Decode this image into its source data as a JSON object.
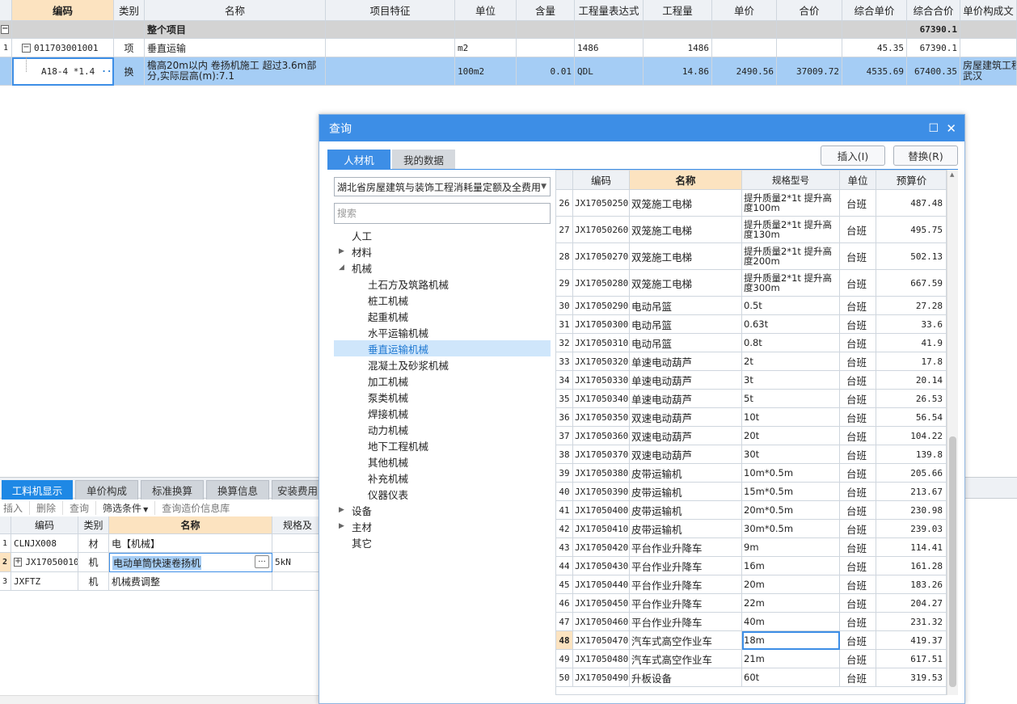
{
  "top_grid": {
    "headers": [
      "编码",
      "类别",
      "名称",
      "项目特征",
      "单位",
      "含量",
      "工程量表达式",
      "工程量",
      "单价",
      "合价",
      "综合单价",
      "综合合价",
      "单价构成文"
    ],
    "summary_row": {
      "name": "整个项目",
      "total": "67390.1"
    },
    "row1": {
      "idx": "1",
      "code": "011703001001",
      "type": "项",
      "name": "垂直运输",
      "unit": "m2",
      "expr": "1486",
      "qty": "1486",
      "unit_price": "45.35",
      "total": "67390.1"
    },
    "row2": {
      "code": "A18-4 *1.4",
      "type": "换",
      "name_line1": "檐高20m以内 卷扬机施工  超过3.6m部",
      "name_line2": "分,实际层高(m):7.1",
      "unit": "100m2",
      "content": "0.01",
      "expr": "QDL",
      "qty": "14.86",
      "price": "2490.56",
      "amount": "37009.72",
      "unit_price": "4535.69",
      "total": "67400.35",
      "source_line1": "房屋建筑工程",
      "source_line2": "武汉"
    }
  },
  "bottom_panel": {
    "tabs": [
      "工料机显示",
      "单价构成",
      "标准换算",
      "换算信息",
      "安装费用"
    ],
    "toolbar": [
      "插入",
      "删除",
      "查询",
      "筛选条件",
      "查询造价信息库"
    ],
    "headers": [
      "编码",
      "类别",
      "名称",
      "规格及"
    ],
    "rows": [
      {
        "idx": "1",
        "code": "CLNJX008",
        "type": "材",
        "name": "电【机械】",
        "spec": ""
      },
      {
        "idx": "2",
        "code": "JX17050010",
        "type": "机",
        "name": "电动单筒快速卷扬机",
        "spec": "5kN"
      },
      {
        "idx": "3",
        "code": "JXFTZ",
        "type": "机",
        "name": "机械费调整",
        "spec": ""
      }
    ]
  },
  "dialog": {
    "title": "查询",
    "tabs": [
      "人材机",
      "我的数据"
    ],
    "insert_button": "插入(I)",
    "replace_button": "替换(R)",
    "quota_select": "湖北省房屋建筑与装饰工程消耗量定额及全费用",
    "search_placeholder": "搜索",
    "tree": [
      {
        "label": "人工",
        "level": 1,
        "arrow": ""
      },
      {
        "label": "材料",
        "level": 1,
        "arrow": "▶"
      },
      {
        "label": "机械",
        "level": 1,
        "arrow": "◢"
      },
      {
        "label": "土石方及筑路机械",
        "level": 2,
        "arrow": ""
      },
      {
        "label": "桩工机械",
        "level": 2,
        "arrow": ""
      },
      {
        "label": "起重机械",
        "level": 2,
        "arrow": ""
      },
      {
        "label": "水平运输机械",
        "level": 2,
        "arrow": ""
      },
      {
        "label": "垂直运输机械",
        "level": 2,
        "arrow": "",
        "selected": true
      },
      {
        "label": "混凝土及砂浆机械",
        "level": 2,
        "arrow": ""
      },
      {
        "label": "加工机械",
        "level": 2,
        "arrow": ""
      },
      {
        "label": "泵类机械",
        "level": 2,
        "arrow": ""
      },
      {
        "label": "焊接机械",
        "level": 2,
        "arrow": ""
      },
      {
        "label": "动力机械",
        "level": 2,
        "arrow": ""
      },
      {
        "label": "地下工程机械",
        "level": 2,
        "arrow": ""
      },
      {
        "label": "其他机械",
        "level": 2,
        "arrow": ""
      },
      {
        "label": "补充机械",
        "level": 2,
        "arrow": ""
      },
      {
        "label": "仪器仪表",
        "level": 2,
        "arrow": ""
      },
      {
        "label": "设备",
        "level": 1,
        "arrow": "▶"
      },
      {
        "label": "主材",
        "level": 1,
        "arrow": "▶"
      },
      {
        "label": "其它",
        "level": 1,
        "arrow": ""
      }
    ],
    "table_headers": [
      "编码",
      "名称",
      "规格型号",
      "单位",
      "预算价"
    ],
    "rows": [
      {
        "n": "26",
        "code": "JX17050250",
        "name": "双笼施工电梯",
        "spec": "提升质量2*1t 提升高度100m",
        "unit": "台班",
        "price": "487.48"
      },
      {
        "n": "27",
        "code": "JX17050260",
        "name": "双笼施工电梯",
        "spec": "提升质量2*1t 提升高度130m",
        "unit": "台班",
        "price": "495.75"
      },
      {
        "n": "28",
        "code": "JX17050270",
        "name": "双笼施工电梯",
        "spec": "提升质量2*1t 提升高度200m",
        "unit": "台班",
        "price": "502.13"
      },
      {
        "n": "29",
        "code": "JX17050280",
        "name": "双笼施工电梯",
        "spec": "提升质量2*1t 提升高度300m",
        "unit": "台班",
        "price": "667.59"
      },
      {
        "n": "30",
        "code": "JX17050290",
        "name": "电动吊篮",
        "spec": "0.5t",
        "unit": "台班",
        "price": "27.28"
      },
      {
        "n": "31",
        "code": "JX17050300",
        "name": "电动吊篮",
        "spec": "0.63t",
        "unit": "台班",
        "price": "33.6"
      },
      {
        "n": "32",
        "code": "JX17050310",
        "name": "电动吊篮",
        "spec": "0.8t",
        "unit": "台班",
        "price": "41.9"
      },
      {
        "n": "33",
        "code": "JX17050320",
        "name": "单速电动葫芦",
        "spec": "2t",
        "unit": "台班",
        "price": "17.8"
      },
      {
        "n": "34",
        "code": "JX17050330",
        "name": "单速电动葫芦",
        "spec": "3t",
        "unit": "台班",
        "price": "20.14"
      },
      {
        "n": "35",
        "code": "JX17050340",
        "name": "单速电动葫芦",
        "spec": "5t",
        "unit": "台班",
        "price": "26.53"
      },
      {
        "n": "36",
        "code": "JX17050350",
        "name": "双速电动葫芦",
        "spec": "10t",
        "unit": "台班",
        "price": "56.54"
      },
      {
        "n": "37",
        "code": "JX17050360",
        "name": "双速电动葫芦",
        "spec": "20t",
        "unit": "台班",
        "price": "104.22"
      },
      {
        "n": "38",
        "code": "JX17050370",
        "name": "双速电动葫芦",
        "spec": "30t",
        "unit": "台班",
        "price": "139.8"
      },
      {
        "n": "39",
        "code": "JX17050380",
        "name": "皮带运输机",
        "spec": "10m*0.5m",
        "unit": "台班",
        "price": "205.66"
      },
      {
        "n": "40",
        "code": "JX17050390",
        "name": "皮带运输机",
        "spec": "15m*0.5m",
        "unit": "台班",
        "price": "213.67"
      },
      {
        "n": "41",
        "code": "JX17050400",
        "name": "皮带运输机",
        "spec": "20m*0.5m",
        "unit": "台班",
        "price": "230.98"
      },
      {
        "n": "42",
        "code": "JX17050410",
        "name": "皮带运输机",
        "spec": "30m*0.5m",
        "unit": "台班",
        "price": "239.03"
      },
      {
        "n": "43",
        "code": "JX17050420",
        "name": "平台作业升降车",
        "spec": "9m",
        "unit": "台班",
        "price": "114.41"
      },
      {
        "n": "44",
        "code": "JX17050430",
        "name": "平台作业升降车",
        "spec": "16m",
        "unit": "台班",
        "price": "161.28"
      },
      {
        "n": "45",
        "code": "JX17050440",
        "name": "平台作业升降车",
        "spec": "20m",
        "unit": "台班",
        "price": "183.26"
      },
      {
        "n": "46",
        "code": "JX17050450",
        "name": "平台作业升降车",
        "spec": "22m",
        "unit": "台班",
        "price": "204.27"
      },
      {
        "n": "47",
        "code": "JX17050460",
        "name": "平台作业升降车",
        "spec": "40m",
        "unit": "台班",
        "price": "231.32"
      },
      {
        "n": "48",
        "code": "JX17050470",
        "name": "汽车式高空作业车",
        "spec": "18m",
        "unit": "台班",
        "price": "419.37",
        "current": true
      },
      {
        "n": "49",
        "code": "JX17050480",
        "name": "汽车式高空作业车",
        "spec": "21m",
        "unit": "台班",
        "price": "617.51"
      },
      {
        "n": "50",
        "code": "JX17050490",
        "name": "升板设备",
        "spec": "60t",
        "unit": "台班",
        "price": "319.53"
      }
    ]
  }
}
